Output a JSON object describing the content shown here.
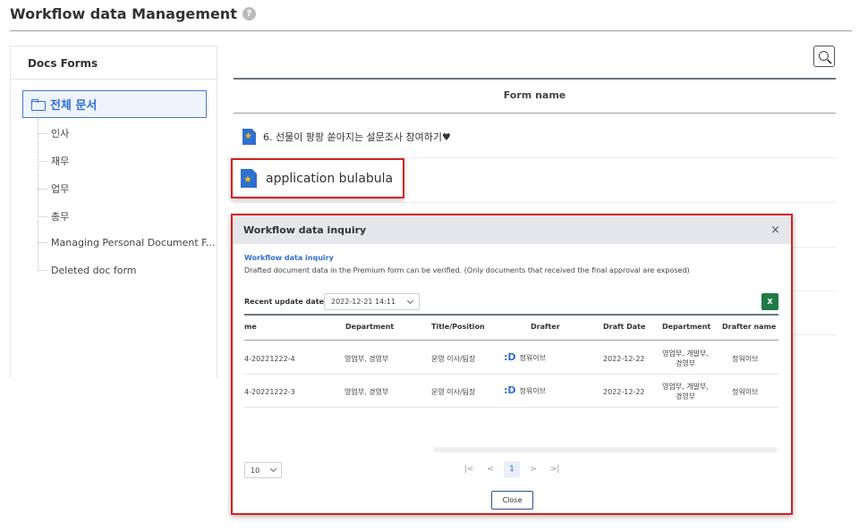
{
  "header": {
    "title": "Workflow data Management",
    "help": "?"
  },
  "sidebar": {
    "title": "Docs Forms",
    "root_label": "전체 문서",
    "items": [
      {
        "label": "인사"
      },
      {
        "label": "재무"
      },
      {
        "label": "업무"
      },
      {
        "label": "총무"
      },
      {
        "label": "Managing Personal Document F..."
      },
      {
        "label": "Deleted doc form"
      }
    ]
  },
  "list": {
    "column_header": "Form name",
    "rows": [
      {
        "label": "6. 선물이 팡팡 쏟아지는 설문조사 참여하기♥"
      },
      {
        "label": "application bulabula"
      }
    ]
  },
  "modal": {
    "title": "Workflow data inquiry",
    "close": "×",
    "subtitle": "Workflow data inquiry",
    "description": "Drafted document data in the Premium form can be verified. (Only documents that received the final approval are exposed)",
    "date_label": "Recent update date",
    "date_value": "2022-12-21 14:11",
    "excel_label": "X",
    "columns": [
      "me",
      "Department",
      "Title/Position",
      "Drafter",
      "Draft Date",
      "Department",
      "Drafter name"
    ],
    "rows": [
      {
        "doc": "4-20221222-4",
        "dept": "영업부, 경영부",
        "title": "운영 이사/팀장",
        "drafter": "정워이브",
        "date": "2022-12-22",
        "dept2_line1": "영업부, 개발부,",
        "dept2_line2": "경영부",
        "name": "정워이브"
      },
      {
        "doc": "4-20221222-3",
        "dept": "영업부, 경영부",
        "title": "운영 이사/팀장",
        "drafter": "정워이브",
        "date": "2022-12-22",
        "dept2_line1": "영업부, 개발부,",
        "dept2_line2": "경영부",
        "name": "정워이브"
      }
    ],
    "page_size": "10",
    "pager": {
      "first": "|<",
      "prev": "<",
      "current": "1",
      "next": ">",
      "last": ">|"
    },
    "close_button": "Close"
  },
  "colors": {
    "accent": "#2f6fd6",
    "highlight_border": "#d42020",
    "excel": "#1f7a45"
  }
}
